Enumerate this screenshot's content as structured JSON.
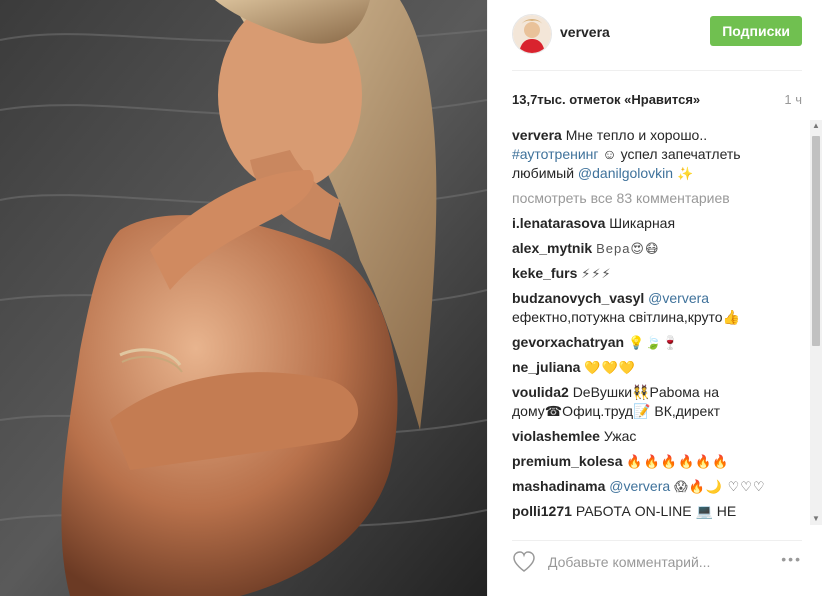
{
  "post": {
    "username": "ververa",
    "follow_label": "Подписки",
    "likes_text": "13,7тыс. отметок «Нравится»",
    "time": "1 ч",
    "caption": {
      "user": "ververa",
      "line1": "Мне тепло и хорошо..",
      "hashtag": "#аутотренинг",
      "line2": "☺ успел запечатлеть",
      "line3": "любимый",
      "mention": "@danilgolovkin",
      "tail": "✨"
    },
    "view_all": "посмотреть все 83 комментариев",
    "comments": [
      {
        "user": "i.lenatarasova",
        "text": "Шикарная"
      },
      {
        "user": "alex_mytnik",
        "text": "Вера😍😷"
      },
      {
        "user": "keke_furs",
        "text": "⚡⚡⚡"
      },
      {
        "user": "budzanovych_vasyl",
        "mention": "@ververa",
        "text": "ефектно,потужна світлина,круто👍"
      },
      {
        "user": "gevorxachatryan",
        "text": "💡🍃🍷"
      },
      {
        "user": "ne_juliana",
        "text": "💛💛💛"
      },
      {
        "user": "voulida2",
        "text": "DeBушки👯Pаboма на дому☎Офиц.труд📝 ВК,директ"
      },
      {
        "user": "violashemlee",
        "text": "Ужас"
      },
      {
        "user": "premium_kolesa",
        "text": "🔥🔥🔥🔥🔥🔥"
      },
      {
        "user": "mashadinama",
        "mention": "@ververa",
        "text": "😱🔥🌙 ♡♡♡"
      },
      {
        "user": "polli1271",
        "text": "РАБОТА ON-LINE 💻 НЕ"
      }
    ],
    "comment_placeholder": "Добавьте комментарий...",
    "more_options": "•••"
  },
  "icons": {
    "heart": "heart-icon",
    "more": "more-options-icon",
    "scroll_up": "scroll-up-arrow",
    "scroll_down": "scroll-down-arrow"
  },
  "colors": {
    "follow": "#70c050",
    "link": "#3f729b",
    "muted": "#999999"
  }
}
